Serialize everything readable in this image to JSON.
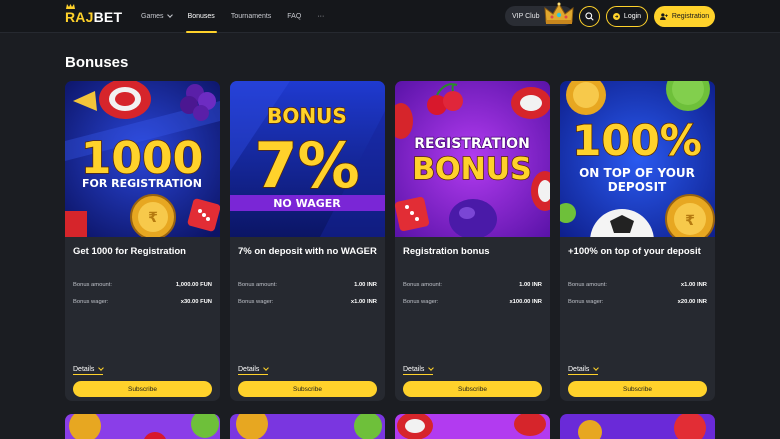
{
  "header": {
    "logo": "RAJBET",
    "nav": [
      {
        "label": "Games"
      },
      {
        "label": "Bonuses"
      },
      {
        "label": "Tournaments"
      },
      {
        "label": "FAQ"
      },
      {
        "label": "···"
      }
    ],
    "vip_label": "VIP Club",
    "login_label": "Login",
    "registration_label": "Registration"
  },
  "page": {
    "title": "Bonuses"
  },
  "cards": [
    {
      "image_text": [
        "1000",
        "FOR REGISTRATION"
      ],
      "name": "Get 1000 for Registration",
      "amount_label": "Bonus amount:",
      "amount": "1,000.00 FUN",
      "wager_label": "Bonus wager:",
      "wager": "x30.00 FUN",
      "details": "Details",
      "button": "Subscribe"
    },
    {
      "image_text": [
        "BONUS",
        "7%",
        "NO WAGER"
      ],
      "name": "7% on deposit with no WAGER",
      "amount_label": "Bonus amount:",
      "amount": "1.00 INR",
      "wager_label": "Bonus wager:",
      "wager": "x1.00 INR",
      "details": "Details",
      "button": "Subscribe"
    },
    {
      "image_text": [
        "REGISTRATION",
        "BONUS"
      ],
      "name": "Registration bonus",
      "amount_label": "Bonus amount:",
      "amount": "1.00 INR",
      "wager_label": "Bonus wager:",
      "wager": "x100.00 INR",
      "details": "Details",
      "button": "Subscribe"
    },
    {
      "image_text": [
        "100%",
        "ON TOP OF YOUR",
        "DEPOSIT"
      ],
      "name": "+100% on top of your deposit",
      "amount_label": "Bonus amount:",
      "amount": "x1.00 INR",
      "wager_label": "Bonus wager:",
      "wager": "x20.00 INR",
      "details": "Details",
      "button": "Subscribe"
    }
  ],
  "colors": {
    "accent": "#ffd22b",
    "background": "#1b1d22",
    "card": "#262930"
  }
}
